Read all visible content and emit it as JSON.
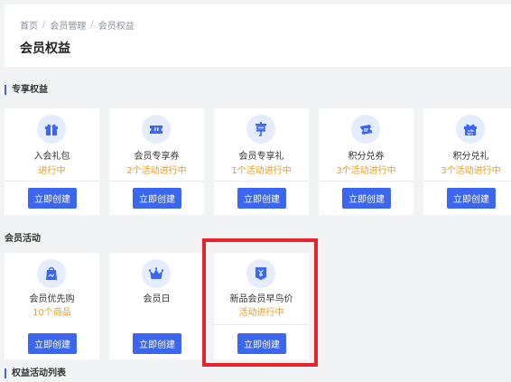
{
  "breadcrumb": [
    "首页",
    "会员管理",
    "会员权益"
  ],
  "breadcrumb_sep": "/",
  "page_title": "会员权益",
  "sections": {
    "exclusive": "专享权益",
    "activities": "会员活动",
    "list": "权益活动列表"
  },
  "exclusive_cards": [
    {
      "name": "入会礼包",
      "status": "进行中",
      "button": "立即创建",
      "icon": "gift-icon"
    },
    {
      "name": "会员专享券",
      "status": "2个活动进行中",
      "button": "立即创建",
      "icon": "ticket-icon"
    },
    {
      "name": "会员专享礼",
      "status": "1个活动进行中",
      "button": "立即创建",
      "icon": "xiang-icon"
    },
    {
      "name": "积分兑券",
      "status": "3个活动进行中",
      "button": "立即创建",
      "icon": "points-coupon-icon"
    },
    {
      "name": "积分兑礼",
      "status": "3个活动进行中",
      "button": "立即创建",
      "icon": "points-gift-icon"
    }
  ],
  "activity_cards": [
    {
      "name": "会员优先购",
      "status": "10个商品",
      "button": "立即创建",
      "icon": "shopping-bag-icon"
    },
    {
      "name": "会员日",
      "status": "",
      "button": "立即创建",
      "icon": "crown-icon"
    },
    {
      "name": "新品会员早鸟价",
      "status": "活动进行中",
      "button": "立即创建",
      "icon": "price-tag-icon"
    }
  ],
  "colors": {
    "primary": "#3a66f0",
    "status": "#f09a16",
    "icon_bg": "#e4ecfd",
    "highlight": "#e8232b"
  }
}
